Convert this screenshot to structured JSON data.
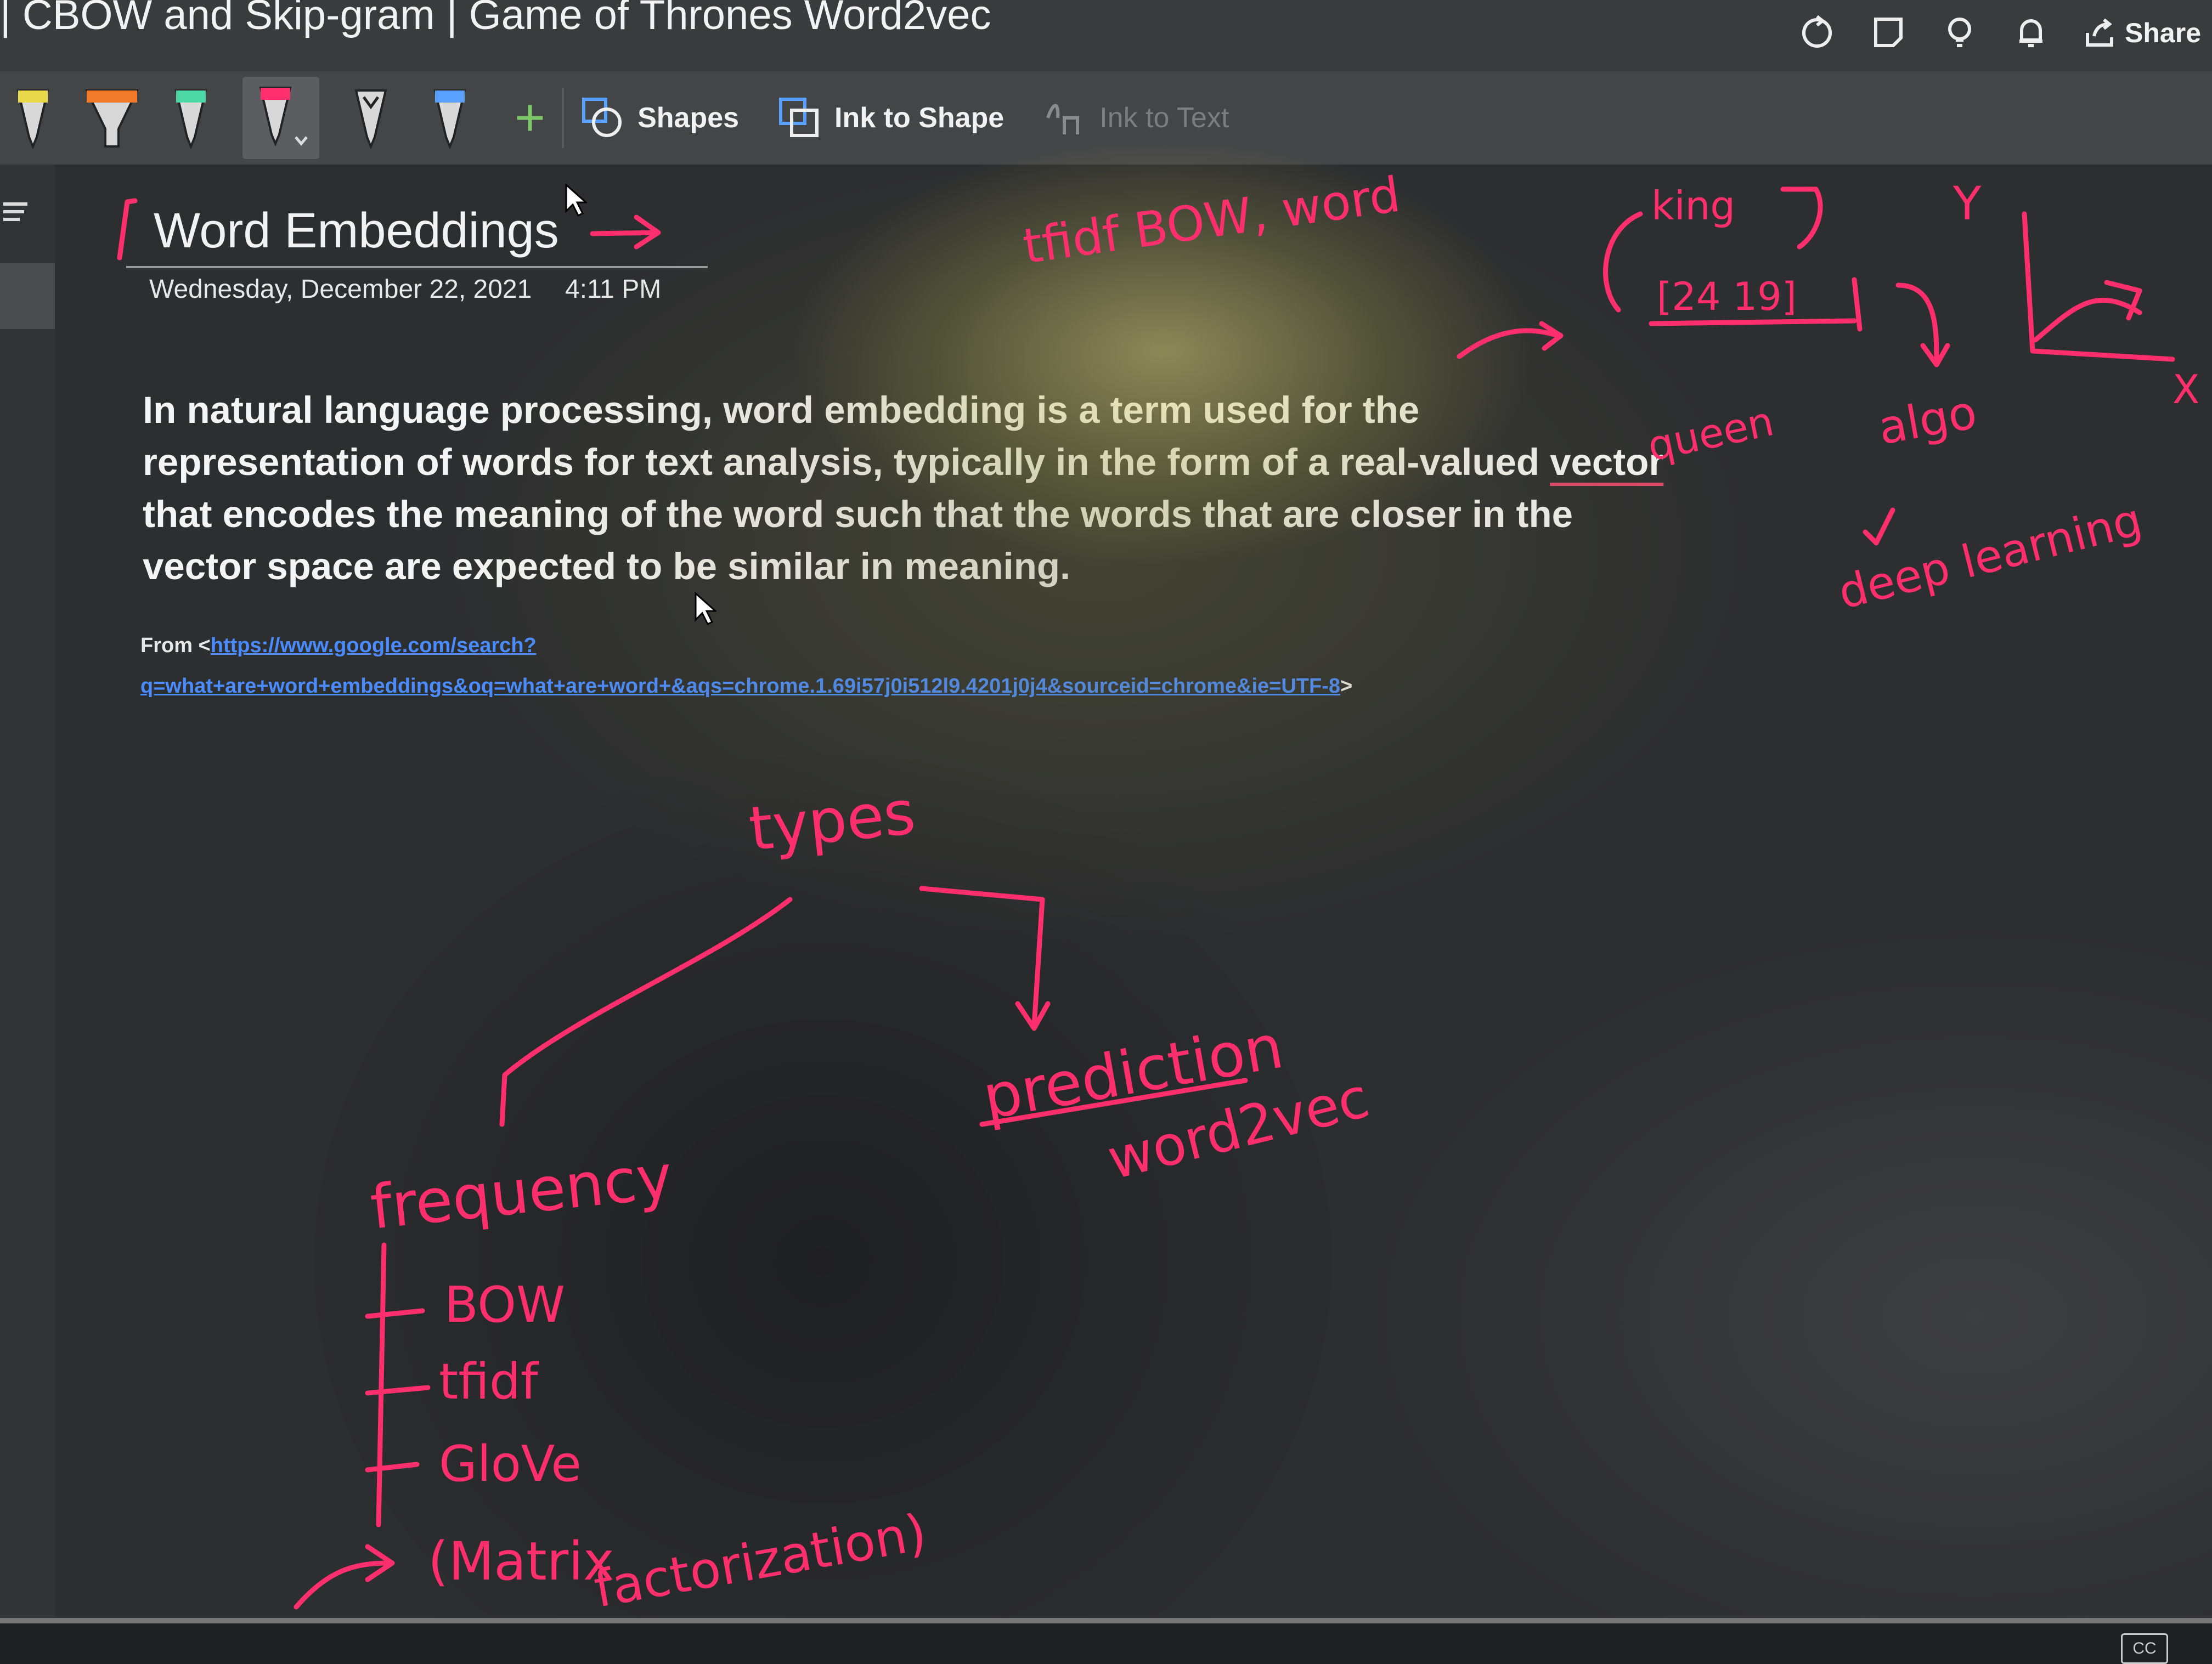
{
  "window": {
    "title": "| CBOW and Skip-gram | Game of Thrones Word2vec",
    "share_label": "Share"
  },
  "toolbar": {
    "pens": [
      {
        "icon": "pen-icon",
        "color": "#e8d94a"
      },
      {
        "icon": "highlighter-icon",
        "color": "#f07a2a"
      },
      {
        "icon": "pen-icon",
        "color": "#4fd9a8"
      },
      {
        "icon": "pen-icon",
        "color": "#ff2f6d",
        "selected": true
      },
      {
        "icon": "pen-icon",
        "color": "#d8d8d8"
      },
      {
        "icon": "pen-icon",
        "color": "#5aa0ff"
      }
    ],
    "shapes_label": "Shapes",
    "ink_to_shape_label": "Ink to Shape",
    "ink_to_text_label": "Ink to Text"
  },
  "page": {
    "title": "Word Embeddings",
    "date": "Wednesday, December 22, 2021",
    "time": "4:11 PM",
    "body_before": "In natural language processing, word embedding is a term used for the representation of words for text analysis, typically in the form of a real-valued ",
    "body_link_word": "vector",
    "body_after": " that encodes the meaning of the word such that the words that are closer in the vector space are expected to be similar in meaning.",
    "source_prefix": "From <",
    "source_url": "https://www.google.com/search?q=what+are+word+embeddings&oq=what+are+word+&aqs=chrome.1.69i57j0i512l9.4201j0j4&sourceid=chrome&ie=UTF-8",
    "source_suffix": ">"
  },
  "ink": {
    "top_note": "tfidf BOW, word",
    "king": "king",
    "vector_values": "[24 19]",
    "queen": "queen",
    "algo": "algo",
    "deep_learning": "deep learning",
    "axis_y": "Y",
    "axis_x": "X",
    "types": "types",
    "prediction": "prediction",
    "word2vec": "word2vec",
    "frequency": "frequency",
    "items": [
      "BOW",
      "tfidf",
      "GloVe"
    ],
    "matrix_factorization_1": "(Matrix",
    "matrix_factorization_2": "factorization)"
  },
  "status": {
    "cc_label": "CC"
  }
}
